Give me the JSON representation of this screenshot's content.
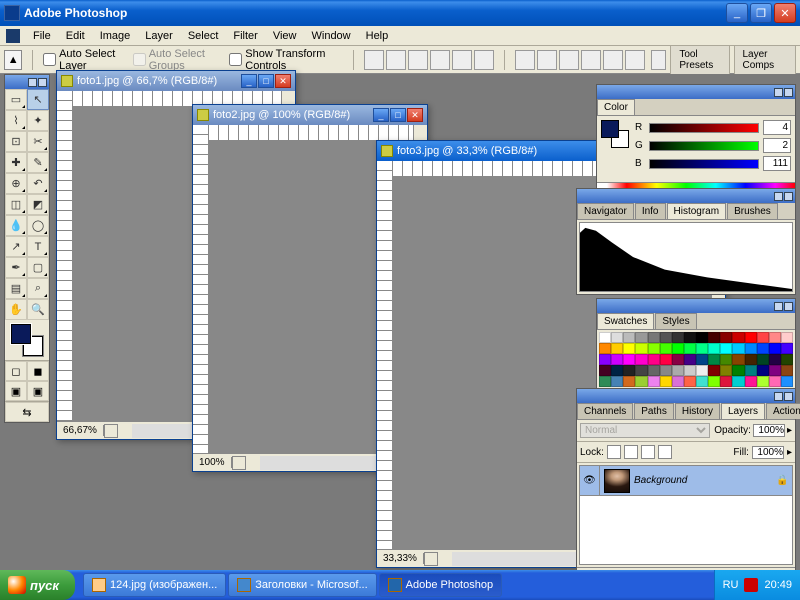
{
  "app": {
    "title": "Adobe Photoshop"
  },
  "menu": [
    "File",
    "Edit",
    "Image",
    "Layer",
    "Select",
    "Filter",
    "View",
    "Window",
    "Help"
  ],
  "options": {
    "autoSelectLayer": "Auto Select Layer",
    "autoSelectGroups": "Auto Select Groups",
    "showTransform": "Show Transform Controls",
    "toolPresets": "Tool Presets",
    "layerComps": "Layer Comps"
  },
  "docs": [
    {
      "title": "foto1.jpg @ 66,7% (RGB/8#)",
      "zoom": "66,67%",
      "active": false
    },
    {
      "title": "foto2.jpg @ 100% (RGB/8#)",
      "zoom": "100%",
      "active": false
    },
    {
      "title": "foto3.jpg @ 33,3% (RGB/8#)",
      "zoom": "33,33%",
      "active": true
    }
  ],
  "colorPanel": {
    "tab": "Color",
    "r": "4",
    "g": "2",
    "b": "111"
  },
  "navPanel": {
    "tabs": [
      "Navigator",
      "Info",
      "Histogram",
      "Brushes"
    ],
    "active": 2
  },
  "swatchPanel": {
    "tabs": [
      "Swatches",
      "Styles"
    ],
    "active": 0
  },
  "layersPanel": {
    "tabs": [
      "Channels",
      "Paths",
      "History",
      "Layers",
      "Actions"
    ],
    "active": 3,
    "blend": "Normal",
    "opacityLabel": "Opacity:",
    "opacity": "100%",
    "lockLabel": "Lock:",
    "fillLabel": "Fill:",
    "fill": "100%",
    "layers": [
      {
        "name": "Background",
        "locked": true
      }
    ]
  },
  "taskbar": {
    "start": "пуск",
    "items": [
      {
        "label": "124.jpg (изображен..."
      },
      {
        "label": "Заголовки - Microsof..."
      },
      {
        "label": "Adobe Photoshop",
        "active": true
      }
    ],
    "lang": "RU",
    "time": "20:49"
  },
  "swatchColors": [
    "#fff",
    "#ddd",
    "#bbb",
    "#999",
    "#777",
    "#555",
    "#333",
    "#111",
    "#000",
    "#400",
    "#800",
    "#c00",
    "#f00",
    "#f44",
    "#f88",
    "#fcc",
    "#f80",
    "#fc0",
    "#ff0",
    "#cf0",
    "#8f0",
    "#4f0",
    "#0f0",
    "#0f4",
    "#0f8",
    "#0fc",
    "#0ff",
    "#0cf",
    "#08f",
    "#04f",
    "#00f",
    "#40f",
    "#80f",
    "#c0f",
    "#f0f",
    "#f0c",
    "#f08",
    "#f04",
    "#804",
    "#408",
    "#048",
    "#084",
    "#480",
    "#840",
    "#420",
    "#042",
    "#204",
    "#240",
    "#402",
    "#024",
    "#222",
    "#444",
    "#666",
    "#888",
    "#aaa",
    "#ccc",
    "#eee",
    "#800000",
    "#808000",
    "#008000",
    "#008080",
    "#000080",
    "#800080",
    "#8b4513",
    "#2e8b57",
    "#4682b4",
    "#d2691e",
    "#9acd32",
    "#ee82ee",
    "#ffd700",
    "#da70d6",
    "#ff6347",
    "#40e0d0",
    "#7fff00",
    "#dc143c",
    "#00ced1",
    "#ff1493",
    "#adff2f",
    "#ff69b4",
    "#1e90ff"
  ]
}
